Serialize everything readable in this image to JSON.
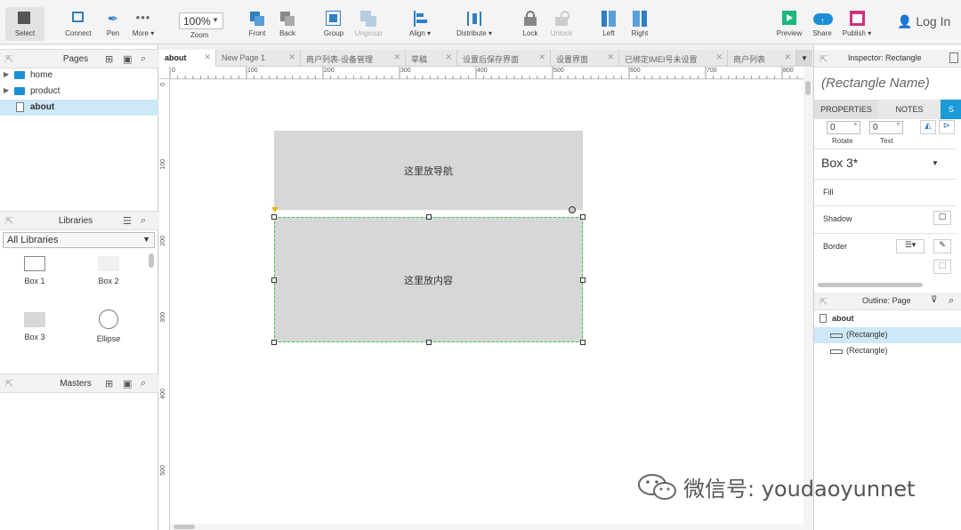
{
  "toolbar": {
    "select": "Select",
    "connect": "Connect",
    "pen": "Pen",
    "more": "More ▾",
    "zoom_value": "100%",
    "zoom_label": "Zoom",
    "front": "Front",
    "back": "Back",
    "group": "Group",
    "ungroup": "Ungroup",
    "align": "Align ▾",
    "distribute": "Distribute ▾",
    "lock": "Lock",
    "unlock": "Unlock",
    "left": "Left",
    "right": "Right",
    "preview": "Preview",
    "share": "Share",
    "publish": "Publish ▾",
    "login": "Log In"
  },
  "pages_panel": {
    "title": "Pages",
    "items": [
      {
        "label": "home"
      },
      {
        "label": "product"
      },
      {
        "label": "about"
      }
    ]
  },
  "libraries_panel": {
    "title": "Libraries",
    "selected": "All Libraries",
    "items": [
      {
        "label": "Box 1"
      },
      {
        "label": "Box 2"
      },
      {
        "label": "Box 3"
      },
      {
        "label": "Ellipse"
      }
    ]
  },
  "masters_panel": {
    "title": "Masters"
  },
  "tabs": [
    {
      "label": "about"
    },
    {
      "label": "New Page 1"
    },
    {
      "label": "商户列表-设备管理"
    },
    {
      "label": "草稿"
    },
    {
      "label": "设置后保存界面"
    },
    {
      "label": "设置界面"
    },
    {
      "label": "已绑定IMEI号未设置"
    },
    {
      "label": "商户列表"
    }
  ],
  "ruler": {
    "top": [
      "0",
      "100",
      "200",
      "300",
      "400",
      "500",
      "600",
      "700",
      "800"
    ],
    "left": [
      "0",
      "100",
      "200",
      "300",
      "400",
      "500"
    ]
  },
  "canvas": {
    "nav_box": "这里放导航",
    "content_box": "这里放内容"
  },
  "inspector": {
    "title": "Inspector: Rectangle",
    "rect_name_placeholder": "(Rectangle Name)",
    "tab_properties": "PROPERTIES",
    "tab_notes": "NOTES",
    "tab_style": "S",
    "rotate_value": "0",
    "rotate_label": "Rotate",
    "text_value": "0",
    "text_label": "Text",
    "style_name": "Box 3*",
    "fill": "Fill",
    "shadow": "Shadow",
    "border": "Border"
  },
  "outline": {
    "title": "Outline: Page",
    "root": "about",
    "items": [
      {
        "label": "(Rectangle)"
      },
      {
        "label": "(Rectangle)"
      }
    ]
  },
  "watermark": "微信号: youdaoyunnet",
  "colors": {
    "accent_blue": "#2f7fc4",
    "selection": "#cde8f7",
    "preview_green": "#1db87a",
    "share_blue": "#1e8fd6",
    "publish_pink": "#d0317f"
  }
}
